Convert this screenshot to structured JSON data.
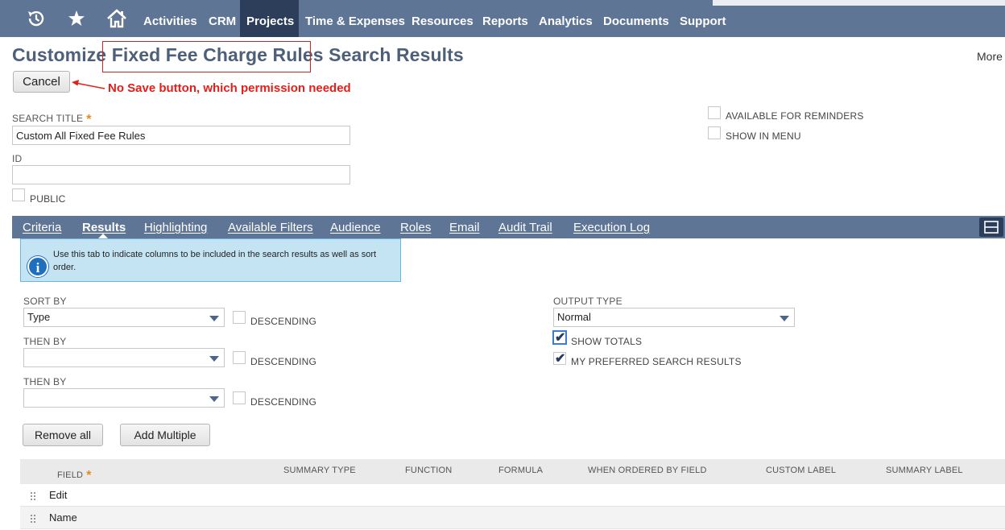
{
  "nav": {
    "icons": [
      "recent-icon",
      "star-icon",
      "home-icon"
    ],
    "items": [
      "Activities",
      "CRM",
      "Projects",
      "Time & Expenses",
      "Resources",
      "Reports",
      "Analytics",
      "Documents",
      "Support"
    ],
    "active": "Projects"
  },
  "page": {
    "title_prefix": "Customize",
    "title_highlight": "Fixed Fee Charge Rules",
    "title_suffix": "Search Results",
    "more": "More",
    "cancel_label": "Cancel",
    "annotation": "No Save button, which permission needed"
  },
  "form": {
    "search_title_label": "SEARCH TITLE",
    "required_mark": "*",
    "search_title_value": "Custom All Fixed Fee Rules",
    "id_label": "ID",
    "id_value": "",
    "public_label": "PUBLIC",
    "public_checked": false,
    "available_reminders_label": "AVAILABLE FOR REMINDERS",
    "show_in_menu_label": "SHOW IN MENU"
  },
  "tabs": [
    "Criteria",
    "Results",
    "Highlighting",
    "Available Filters",
    "Audience",
    "Roles",
    "Email",
    "Audit Trail",
    "Execution Log"
  ],
  "active_tab": "Results",
  "info": {
    "text": "Use this tab to indicate columns to be included in the search results as well as sort order."
  },
  "results": {
    "sort_by_label": "SORT BY",
    "sort_by_value": "Type",
    "then_by_label": "THEN BY",
    "then_by_1_value": "",
    "then_by_2_value": "",
    "descending_label": "DESCENDING",
    "output_type_label": "OUTPUT TYPE",
    "output_type_value": "Normal",
    "show_totals_label": "SHOW TOTALS",
    "show_totals_checked": true,
    "preferred_label": "MY PREFERRED SEARCH RESULTS",
    "preferred_checked": true,
    "remove_all_label": "Remove all",
    "add_multiple_label": "Add Multiple"
  },
  "table": {
    "columns": [
      "FIELD",
      "SUMMARY TYPE",
      "FUNCTION",
      "FORMULA",
      "WHEN ORDERED BY FIELD",
      "CUSTOM LABEL",
      "SUMMARY LABEL"
    ],
    "rows": [
      "Edit",
      "Name"
    ]
  },
  "colors": {
    "nav_bg": "#5f7596",
    "nav_active": "#2c3e5a",
    "title": "#4d5f79",
    "annotation": "#e0201b",
    "info_bg": "#c5e4f3",
    "required": "#e38b1f"
  }
}
